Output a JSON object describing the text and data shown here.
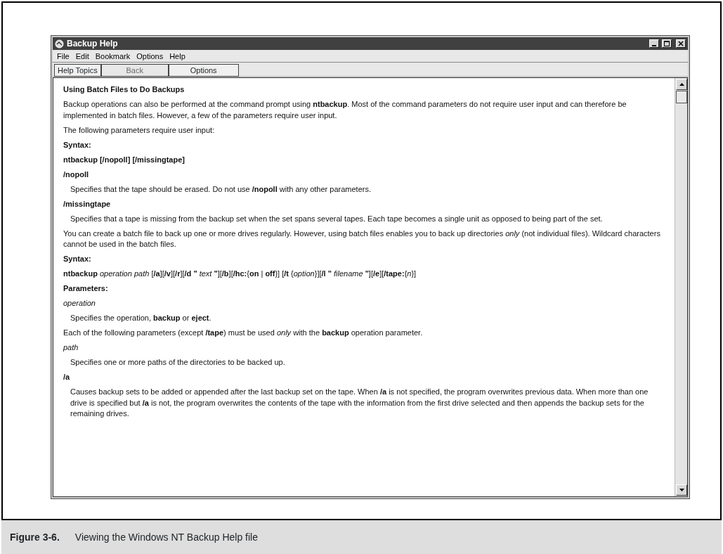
{
  "window": {
    "title": "Backup Help"
  },
  "menu": [
    "File",
    "Edit",
    "Bookmark",
    "Options",
    "Help"
  ],
  "toolbar": [
    {
      "label": "Help Topics",
      "disabled": false
    },
    {
      "label": "Back",
      "disabled": true
    },
    {
      "label": "Options",
      "disabled": false
    }
  ],
  "content": [
    {
      "kind": "heading",
      "text": "Using Batch Files to Do Backups"
    },
    {
      "kind": "para",
      "text": "Backup operations can also be performed at the command prompt using **ntbackup**. Most of the command parameters do not require user input and can therefore be implemented in batch files. However, a few of the parameters require user input."
    },
    {
      "kind": "para",
      "text": "The following parameters require user input:"
    },
    {
      "kind": "term",
      "text": "Syntax:"
    },
    {
      "kind": "term",
      "text": "ntbackup [/nopoll] [/missingtape]"
    },
    {
      "kind": "term",
      "text": "/nopoll"
    },
    {
      "kind": "indent",
      "text": "Specifies that the tape should be erased. Do not use **/nopoll** with any other parameters."
    },
    {
      "kind": "term",
      "text": "/missingtape"
    },
    {
      "kind": "indent",
      "text": "Specifies that a tape is missing from the backup set when the set spans several tapes. Each tape becomes a single unit as opposed to being part of the set."
    },
    {
      "kind": "para",
      "text": "You can create a batch file to back up one or more drives regularly. However, using batch files enables you to back up directories *only* (not individual files). Wildcard characters cannot be used in the batch files."
    },
    {
      "kind": "term",
      "text": "Syntax:"
    },
    {
      "kind": "para",
      "text": "**ntbackup** *operation* *path* [**/a**][**/v**][**/r**][**/d \"** *text* **\"**][**/b**][**/hc:**{**on** | **off**}] [**/t** {*option*}][**/l \"** *filename* **\"**][**/e**][**/tape:**{*n*}]"
    },
    {
      "kind": "term",
      "text": "Parameters:"
    },
    {
      "kind": "param",
      "text": "operation"
    },
    {
      "kind": "indent",
      "text": "Specifies the operation, **backup** or **eject**."
    },
    {
      "kind": "para",
      "text": "Each of the following parameters (except **/tape**) must be used *only* with the **backup** operation parameter."
    },
    {
      "kind": "param",
      "text": "path"
    },
    {
      "kind": "indent",
      "text": "Specifies one or more paths of the directories to be backed up."
    },
    {
      "kind": "term",
      "text": "/a"
    },
    {
      "kind": "indent",
      "text": "Causes backup sets to be added or appended after the last backup set on the tape. When **/a** is not specified, the program overwrites previous data. When more than one drive is specified but **/a** is not, the program overwrites the contents of the tape with the information from the first drive selected and then appends the backup sets for the remaining drives."
    }
  ],
  "caption": {
    "number": "Figure 3-6.",
    "text": "Viewing the Windows NT Backup Help file"
  }
}
